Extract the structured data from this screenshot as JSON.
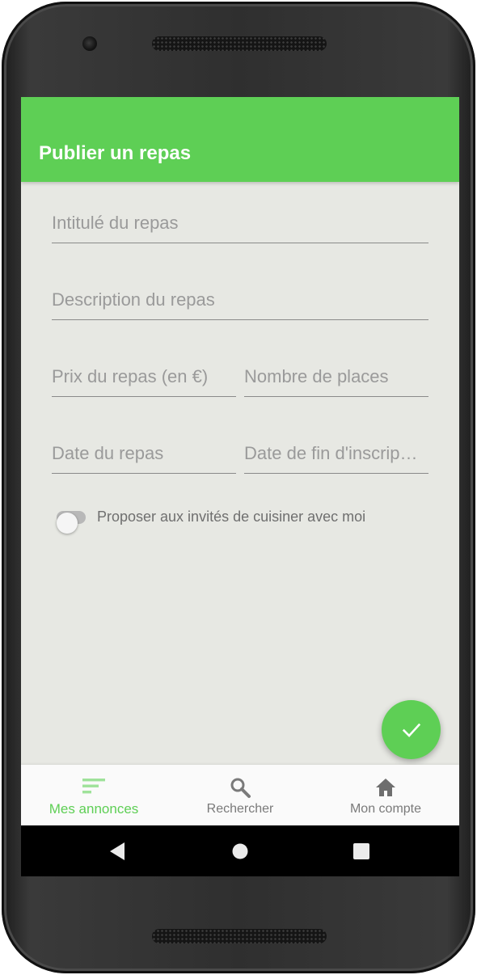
{
  "app_bar": {
    "title": "Publier un repas",
    "color": "#5ecf55"
  },
  "form": {
    "title_placeholder": "Intitulé du repas",
    "description_placeholder": "Description du repas",
    "price_placeholder": "Prix du repas (en €)",
    "places_placeholder": "Nombre de places",
    "date_placeholder": "Date du repas",
    "end_date_placeholder": "Date de fin d'inscrip…",
    "cook_together_label": "Proposer aux invités de cuisiner avec moi",
    "cook_together_enabled": false
  },
  "fab": {
    "icon": "check-icon"
  },
  "bottom_nav": {
    "items": [
      {
        "label": "Mes annonces",
        "icon": "sort-lines-icon",
        "active": true
      },
      {
        "label": "Rechercher",
        "icon": "search-icon",
        "active": false
      },
      {
        "label": "Mon compte",
        "icon": "home-icon",
        "active": false
      }
    ]
  },
  "system_nav": {
    "buttons": [
      "back-icon",
      "home-circle-icon",
      "recents-square-icon"
    ]
  },
  "colors": {
    "accent": "#5ecf55",
    "background": "#e7e8e3",
    "inactive_text": "#7a7a7a"
  }
}
